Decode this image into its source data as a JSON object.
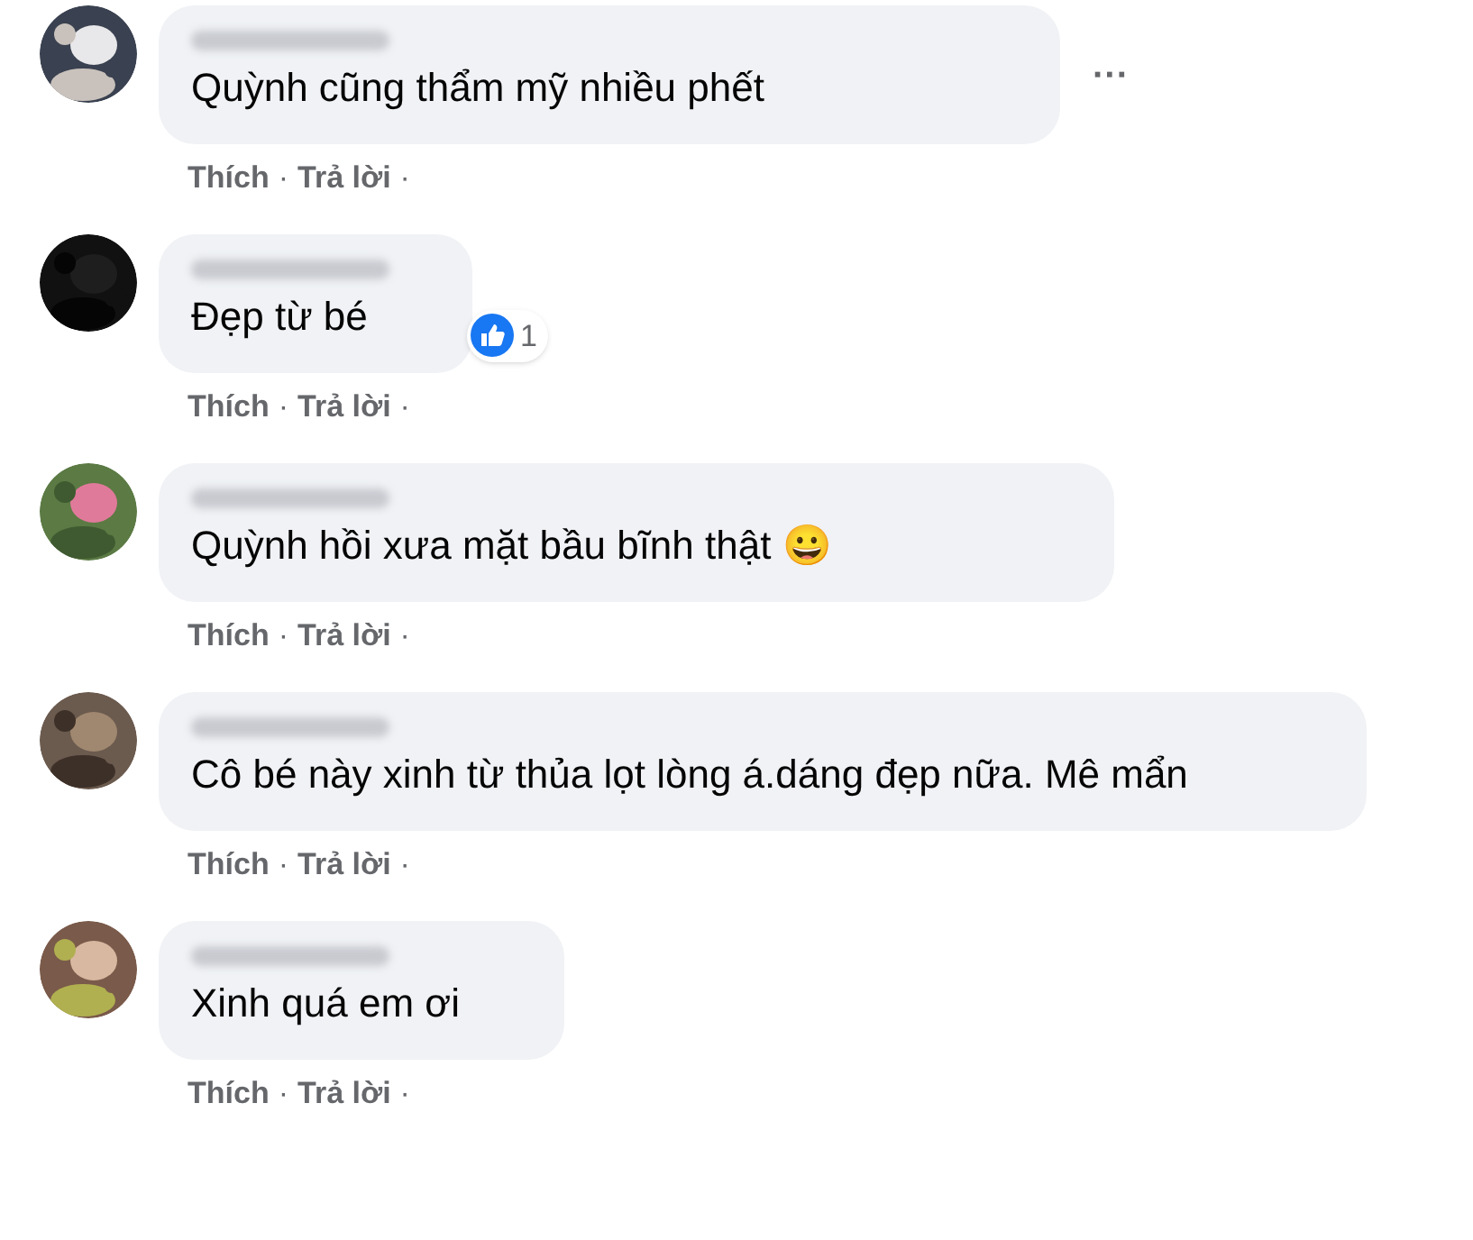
{
  "comments": [
    {
      "name_hidden": true,
      "text": "Quỳnh cũng thẩm mỹ nhiều phết",
      "more_menu": "···",
      "actions": [
        "Thích",
        "Trả lời"
      ],
      "separator": "·"
    },
    {
      "name_hidden": true,
      "text": "Đẹp từ bé",
      "reaction": {
        "count": "1"
      },
      "actions": [
        "Thích",
        "Trả lời"
      ],
      "separator": "·"
    },
    {
      "name_hidden": true,
      "text": "Quỳnh hồi xưa mặt bầu bĩnh thật 😀",
      "actions": [
        "Thích",
        "Trả lời"
      ],
      "separator": "·"
    },
    {
      "name_hidden": true,
      "text": "Cô bé này xinh từ thủa lọt lòng á.dáng đẹp nữa. Mê mẩn",
      "actions": [
        "Thích",
        "Trả lời"
      ],
      "separator": "·"
    },
    {
      "name_hidden": true,
      "text": "Xinh quá em ơi",
      "actions": [
        "Thích",
        "Trả lời"
      ],
      "separator": "·"
    }
  ]
}
